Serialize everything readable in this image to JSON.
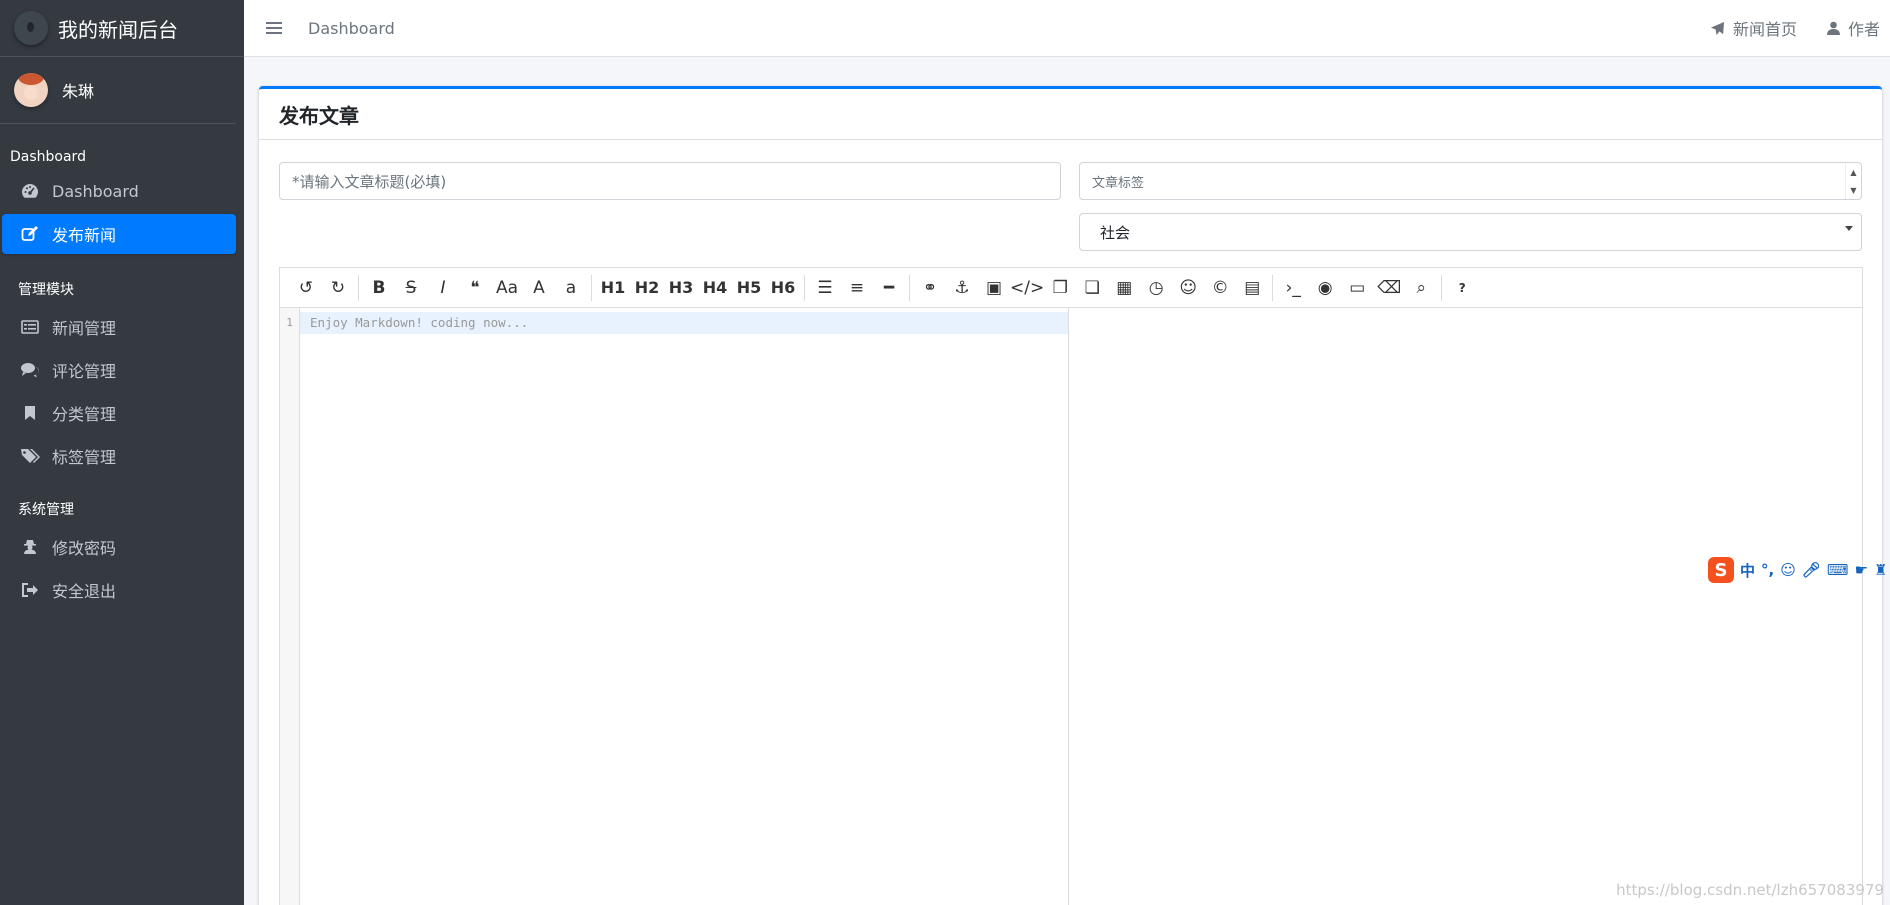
{
  "brand": {
    "title": "我的新闻后台"
  },
  "user": {
    "name": "朱琳"
  },
  "sidebar": {
    "sections": [
      {
        "header": "Dashboard",
        "items": [
          {
            "label": "Dashboard",
            "icon": "dashboard-icon",
            "active": false
          },
          {
            "label": "发布新闻",
            "icon": "edit-icon",
            "active": true
          }
        ]
      },
      {
        "header": "管理模块",
        "items": [
          {
            "label": "新闻管理",
            "icon": "list-icon",
            "active": false
          },
          {
            "label": "评论管理",
            "icon": "comments-icon",
            "active": false
          },
          {
            "label": "分类管理",
            "icon": "bookmark-icon",
            "active": false
          },
          {
            "label": "标签管理",
            "icon": "tags-icon",
            "active": false
          }
        ]
      },
      {
        "header": "系统管理",
        "items": [
          {
            "label": "修改密码",
            "icon": "user-secret-icon",
            "active": false
          },
          {
            "label": "安全退出",
            "icon": "sign-out-icon",
            "active": false
          }
        ]
      }
    ]
  },
  "header": {
    "breadcrumb": "Dashboard",
    "news_home": "新闻首页",
    "author": "作者"
  },
  "card": {
    "title": "发布文章",
    "title_placeholder": "*请输入文章标题(必填)",
    "tag_placeholder": "文章标签",
    "category_selected": "社会"
  },
  "editor": {
    "line_number": "1",
    "placeholder": "Enjoy Markdown! coding now...",
    "toolbar": [
      [
        "undo-icon",
        "redo-icon"
      ],
      [
        "bold-icon",
        "strikethrough-icon",
        "italic-icon",
        "quote-icon",
        "uppercase-icon",
        "ucwords-icon",
        "lowercase-icon"
      ],
      [
        "H1",
        "H2",
        "H3",
        "H4",
        "H5",
        "H6"
      ],
      [
        "unordered-list-icon",
        "ordered-list-icon",
        "horizontal-rule-icon"
      ],
      [
        "link-icon",
        "anchor-icon",
        "image-icon",
        "code-icon",
        "code-block-icon",
        "preformatted-icon",
        "table-icon",
        "datetime-icon",
        "emoji-icon",
        "html-entities-icon",
        "pagebreak-icon"
      ],
      [
        "goto-line-icon",
        "watch-icon",
        "preview-icon",
        "clear-icon",
        "search-icon"
      ],
      [
        "help-icon"
      ]
    ]
  },
  "ime": {
    "lang": "中"
  },
  "watermark": "https://blog.csdn.net/lzh657083979",
  "colors": {
    "sidebar_bg": "#343a40",
    "accent": "#007bff"
  }
}
